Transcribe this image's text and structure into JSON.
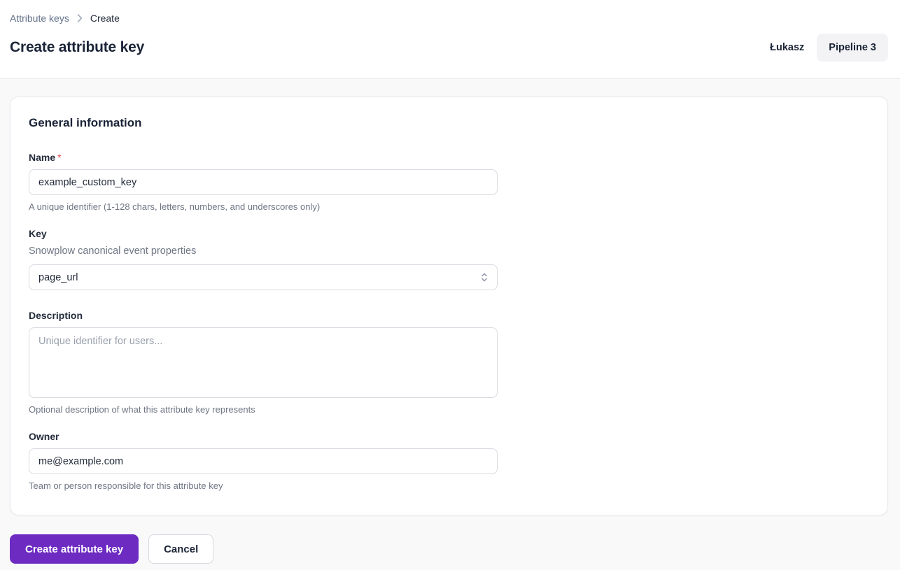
{
  "breadcrumb": {
    "parent": "Attribute keys",
    "current": "Create"
  },
  "header": {
    "title": "Create attribute key",
    "user_name": "Łukasz",
    "pipeline_label": "Pipeline 3"
  },
  "card": {
    "section_title": "General information",
    "name": {
      "label": "Name",
      "required_marker": "*",
      "value": "example_custom_key",
      "helper": "A unique identifier (1-128 chars, letters, numbers, and underscores only)"
    },
    "key": {
      "label": "Key",
      "subtitle": "Snowplow canonical event properties",
      "selected_option": "page_url"
    },
    "description": {
      "label": "Description",
      "placeholder": "Unique identifier for users...",
      "helper": "Optional description of what this attribute key represents"
    },
    "owner": {
      "label": "Owner",
      "value": "me@example.com",
      "helper": "Team or person responsible for this attribute key"
    }
  },
  "actions": {
    "submit_label": "Create attribute key",
    "cancel_label": "Cancel"
  },
  "icons": {
    "breadcrumb_separator": "chevron-right-icon",
    "select_caret": "unfold-more-icon"
  },
  "colors": {
    "primary_purple": "#6d2bc2",
    "required_red": "#e5484d",
    "page_background": "#f9f9fa",
    "header_background": "#ffffff",
    "pipeline_chip_background": "#f3f3f5",
    "input_border": "#d7dae0",
    "helper_text": "#6f7684",
    "heading_text": "#1b2437"
  }
}
